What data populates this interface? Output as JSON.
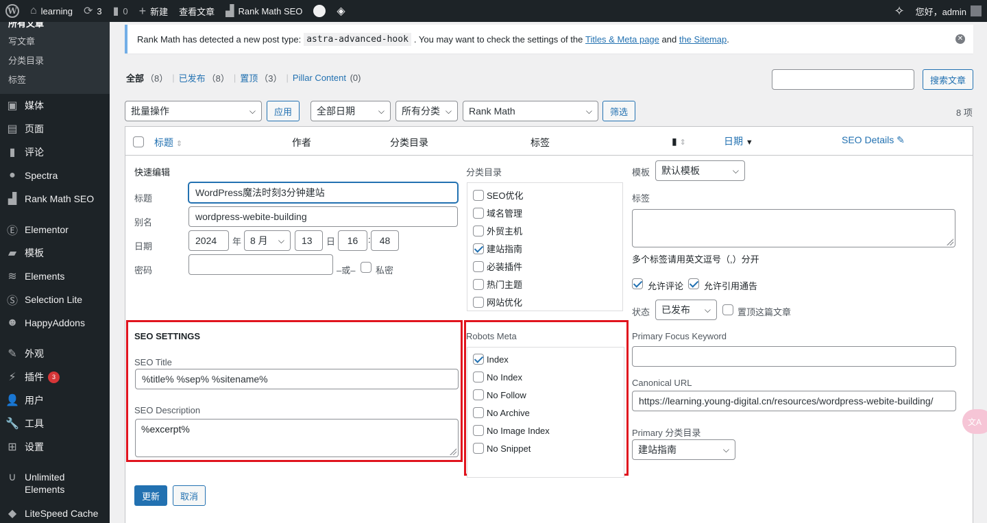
{
  "adminbar": {
    "site_name": "learning",
    "updates_count": "3",
    "comments_count": "0",
    "new_label": "新建",
    "view_posts": "查看文章",
    "rank_math": "Rank Math SEO",
    "greeting": "您好，admin"
  },
  "sidebar": {
    "posts_sub": [
      "所有文章",
      "写文章",
      "分类目录",
      "标签"
    ],
    "menu": [
      {
        "label": "媒体",
        "icon": "media-icon"
      },
      {
        "label": "页面",
        "icon": "pages-icon"
      },
      {
        "label": "评论",
        "icon": "comments-icon"
      },
      {
        "label": "Spectra",
        "icon": "spectra-icon"
      },
      {
        "label": "Rank Math SEO",
        "icon": "rankmath-icon"
      },
      {
        "label": "Elementor",
        "icon": "elementor-icon"
      },
      {
        "label": "模板",
        "icon": "templates-icon"
      },
      {
        "label": "Elements",
        "icon": "elements-icon"
      },
      {
        "label": "Selection Lite",
        "icon": "selection-icon"
      },
      {
        "label": "HappyAddons",
        "icon": "happyaddons-icon"
      },
      {
        "label": "外观",
        "icon": "appearance-icon"
      },
      {
        "label": "插件",
        "icon": "plugins-icon",
        "badge": "3"
      },
      {
        "label": "用户",
        "icon": "users-icon"
      },
      {
        "label": "工具",
        "icon": "tools-icon"
      },
      {
        "label": "设置",
        "icon": "settings-icon"
      },
      {
        "label": "Unlimited Elements",
        "icon": "unlimited-icon"
      },
      {
        "label": "LiteSpeed Cache",
        "icon": "litespeed-icon"
      }
    ]
  },
  "notice": {
    "text_before": "Rank Math has detected a new post type:",
    "code": "astra-advanced-hook",
    "text_middle": ". You may want to check the settings of the",
    "link1": "Titles & Meta page",
    "and": "and",
    "link2": "the Sitemap",
    "end": "."
  },
  "views": {
    "all": "全部",
    "all_count": "（8）",
    "published": "已发布",
    "published_count": "（8）",
    "sticky": "置顶",
    "sticky_count": "（3）",
    "pillar": "Pillar Content",
    "pillar_count": "(0)"
  },
  "search_button": "搜索文章",
  "filters": {
    "bulk": "批量操作",
    "apply": "应用",
    "dates": "全部日期",
    "cats": "所有分类",
    "rankmath": "Rank Math",
    "filter": "筛选",
    "items": "8 项"
  },
  "columns": {
    "title": "标题",
    "author": "作者",
    "categories": "分类目录",
    "tags": "标签",
    "date": "日期",
    "seo": "SEO Details"
  },
  "quick_edit": {
    "heading": "快速编辑",
    "title_label": "标题",
    "title_value": "WordPress魔法时刻3分钟建站",
    "slug_label": "别名",
    "slug_value": "wordpress-webite-building",
    "date_label": "日期",
    "year": "2024",
    "year_suffix": "年",
    "month": "8 月",
    "day": "13",
    "day_suffix": "日",
    "hour": "16",
    "colon": ":",
    "minute": "48",
    "password_label": "密码",
    "or": "–或–",
    "private": "私密",
    "cat_heading": "分类目录",
    "categories": [
      {
        "label": "SEO优化",
        "checked": false
      },
      {
        "label": "域名管理",
        "checked": false
      },
      {
        "label": "外贸主机",
        "checked": false
      },
      {
        "label": "建站指南",
        "checked": true
      },
      {
        "label": "必装插件",
        "checked": false
      },
      {
        "label": "热门主题",
        "checked": false
      },
      {
        "label": "网站优化",
        "checked": false
      }
    ],
    "template_label": "模板",
    "template_value": "默认模板",
    "tags_label": "标签",
    "tags_hint": "多个标签请用英文逗号（,）分开",
    "allow_comments": "允许评论",
    "allow_pings": "允许引用通告",
    "status_label": "状态",
    "status_value": "已发布",
    "sticky_label": "置顶这篇文章"
  },
  "seo": {
    "heading": "SEO SETTINGS",
    "title_label": "SEO Title",
    "title_value": "%title% %sep% %sitename%",
    "desc_label": "SEO Description",
    "desc_value": "%excerpt%",
    "robots_heading": "Robots Meta",
    "robots": [
      {
        "label": "Index",
        "checked": true
      },
      {
        "label": "No Index",
        "checked": false
      },
      {
        "label": "No Follow",
        "checked": false
      },
      {
        "label": "No Archive",
        "checked": false
      },
      {
        "label": "No Image Index",
        "checked": false
      },
      {
        "label": "No Snippet",
        "checked": false
      }
    ],
    "focus_label": "Primary Focus Keyword",
    "canonical_label": "Canonical URL",
    "canonical_value": "https://learning.young-digital.cn/resources/wordpress-webite-building/",
    "primary_cat_label": "Primary 分类目录",
    "primary_cat_value": "建站指南"
  },
  "actions": {
    "update": "更新",
    "cancel": "取消"
  },
  "translate_bubble": "文A"
}
